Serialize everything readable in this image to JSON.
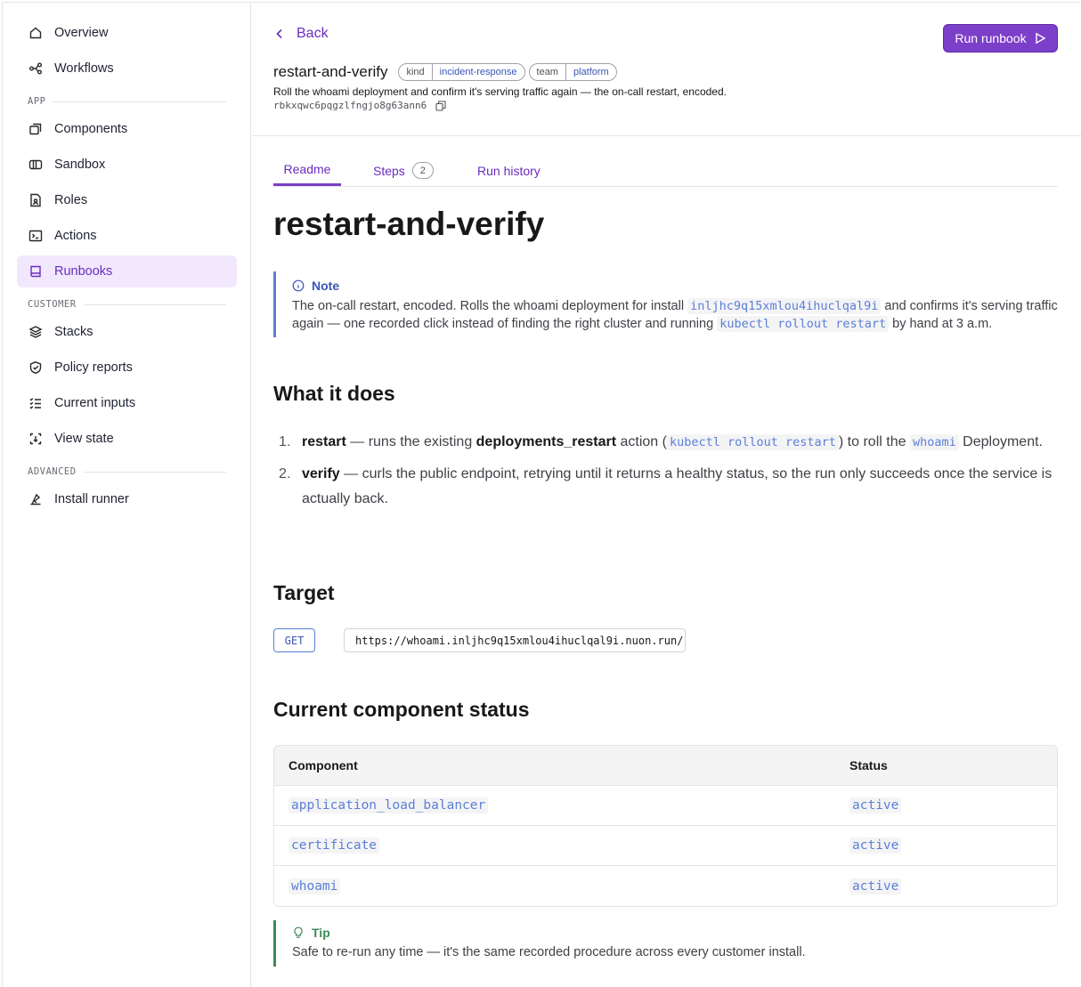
{
  "sidebar": {
    "items": [
      {
        "label": "Overview",
        "icon": "home-icon"
      },
      {
        "label": "Workflows",
        "icon": "workflow-icon"
      },
      {
        "label": "Components",
        "icon": "components-icon"
      },
      {
        "label": "Sandbox",
        "icon": "sandbox-icon"
      },
      {
        "label": "Roles",
        "icon": "roles-icon"
      },
      {
        "label": "Actions",
        "icon": "terminal-icon"
      },
      {
        "label": "Runbooks",
        "icon": "book-icon",
        "active": true
      },
      {
        "label": "Stacks",
        "icon": "layers-icon"
      },
      {
        "label": "Policy reports",
        "icon": "shield-check-icon"
      },
      {
        "label": "Current inputs",
        "icon": "list-check-icon"
      },
      {
        "label": "View state",
        "icon": "state-icon"
      },
      {
        "label": "Install runner",
        "icon": "runner-icon"
      }
    ],
    "sections": {
      "app": "APP",
      "customer": "CUSTOMER",
      "advanced": "ADVANCED"
    }
  },
  "header": {
    "back_label": "Back",
    "title": "restart-and-verify",
    "tags": [
      {
        "key": "kind",
        "value": "incident-response"
      },
      {
        "key": "team",
        "value": "platform"
      }
    ],
    "description": "Roll the whoami deployment and confirm it's serving traffic again — the on-call restart, encoded.",
    "id": "rbkxqwc6pqgzlfngjo8g63ann6",
    "run_button": "Run runbook"
  },
  "tabs": {
    "readme": "Readme",
    "steps": "Steps",
    "steps_count": "2",
    "history": "Run history"
  },
  "readme": {
    "title": "restart-and-verify",
    "note": {
      "label": "Note",
      "t1": "The on-call restart, encoded. Rolls the whoami deployment for install ",
      "install_id": "inljhc9q15xmlou4ihuclqal9i",
      "t2": " and confirms it's serving traffic again — one recorded click instead of finding the right cluster and running ",
      "cmd": "kubectl rollout restart",
      "t3": " by hand at 3 a.m."
    },
    "what_heading": "What it does",
    "step1": {
      "num": "1.",
      "name": "restart",
      "t1": " — runs the existing ",
      "action": "deployments_restart",
      "t2": " action (",
      "cmd": "kubectl rollout restart",
      "t3": ") to roll the ",
      "target": "whoami",
      "t4": " Deployment."
    },
    "step2": {
      "num": "2.",
      "name": "verify",
      "t1": " — curls the public endpoint, retrying until it returns a healthy status, so the run only succeeds once the service is actually back."
    },
    "target_heading": "Target",
    "method": "GET",
    "url": "https://whoami.inljhc9q15xmlou4ihuclqal9i.nuon.run/",
    "status_heading": "Current component status",
    "table": {
      "headers": {
        "component": "Component",
        "status": "Status"
      },
      "rows": [
        {
          "component": "application_load_balancer",
          "status": "active"
        },
        {
          "component": "certificate",
          "status": "active"
        },
        {
          "component": "whoami",
          "status": "active"
        }
      ]
    },
    "tip": {
      "label": "Tip",
      "text": "Safe to re-run any time — it's the same recorded procedure across every customer install."
    }
  },
  "colors": {
    "accent": "#7c3fc9",
    "active_nav_bg": "#f1e8fd",
    "note_border": "#5b7fd6",
    "tip_border": "#3d8a55"
  }
}
